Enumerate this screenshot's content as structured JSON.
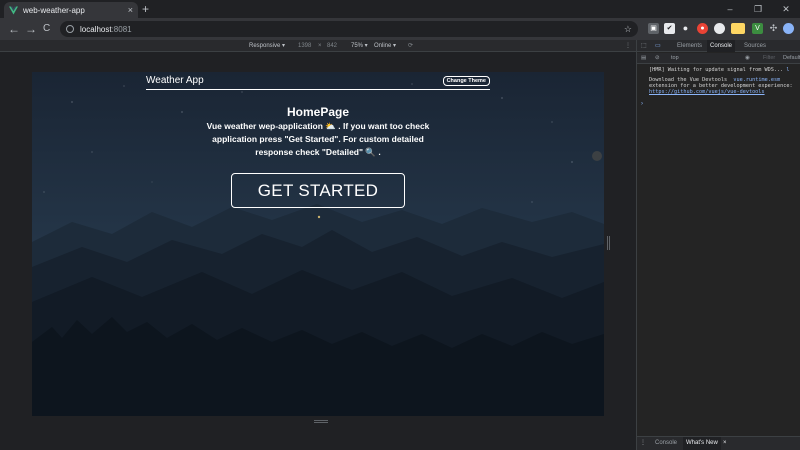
{
  "browser": {
    "tab_title": "web-weather-app",
    "tab_close": "×",
    "new_tab": "+",
    "window_controls": [
      "–",
      "❐",
      "✕"
    ],
    "nav": {
      "back": "←",
      "forward": "→",
      "reload": "C"
    },
    "url_host": "localhost",
    "url_port": ":8081",
    "bookmark_icon": "star-icon"
  },
  "device_toolbar": {
    "mode": "Responsive ▾",
    "width": "1398",
    "times": "×",
    "height": "842",
    "zoom": "75% ▾",
    "throttle": "Online ▾"
  },
  "app": {
    "title": "Weather App",
    "theme_button": "Change Theme",
    "heading": "HomePage",
    "description": "Vue weather wep-application ⛅ . If you want too check application press \"Get Started\". For custom detailed response check \"Detailed\" 🔍 .",
    "start_button": "GET STARTED"
  },
  "devtools": {
    "tabs": [
      "Elements",
      "Console",
      "Sources"
    ],
    "active_tab": "Console",
    "context": "top",
    "filter_placeholder": "Filter",
    "levels": "Default",
    "logs": [
      {
        "text": "[HMR] Waiting for update signal from WDS...",
        "source": "l"
      },
      {
        "text": "Download the Vue Devtools",
        "source": "vue.runtime.esm"
      },
      {
        "text": "extension for a better development experience:",
        "source": ""
      },
      {
        "text": "https://github.com/vuejs/vue-devtools",
        "source": ""
      }
    ],
    "prompt": "›",
    "drawer_tabs": [
      "Console",
      "What's New"
    ],
    "drawer_close": "×"
  },
  "colors": {
    "accent": "#8ab4f8",
    "sky_top": "#1e2b3b",
    "sky_bottom": "#26384a",
    "mountains": "#16202b",
    "forest": "#0d141c"
  }
}
